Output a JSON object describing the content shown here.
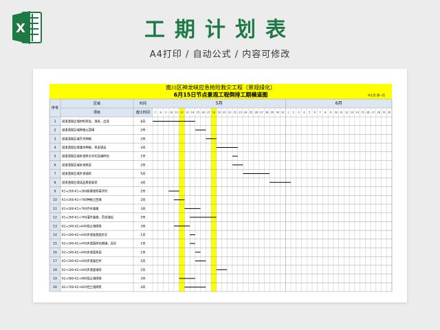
{
  "header": {
    "title": "工期计划表",
    "subtitle": "A4打印 / 自动公式 / 内容可修改",
    "app_icon": "excel-icon",
    "icon_letter": "X"
  },
  "sheet": {
    "project_title": "南川区神龙峡应急抢险救灾工程（景观绿化）",
    "chart_title": "6月15日节点景观工程倒排工期横道图",
    "page_info": "共七页  第一页",
    "columns": {
      "seq": "序号",
      "area": "区域",
      "time": "时间",
      "item": "项目",
      "duration": "施工时间"
    },
    "months": [
      "5月",
      "6月"
    ],
    "may_days": [
      "7",
      "8",
      "9",
      "10",
      "11",
      "12",
      "13",
      "14",
      "15",
      "16",
      "17",
      "18",
      "19",
      "20",
      "21",
      "22",
      "23",
      "24",
      "25",
      "26",
      "27",
      "28",
      "29",
      "30",
      "31"
    ],
    "june_days": [
      "1",
      "2",
      "3",
      "4",
      "5",
      "6",
      "7",
      "8",
      "9",
      "10",
      "11",
      "12",
      "13",
      "14",
      "15",
      "16",
      "17",
      "18",
      "19",
      "20"
    ],
    "highlight_days": [
      "12",
      "18"
    ],
    "rows": [
      {
        "no": "1",
        "item": "道道洒家区域材料转运、清表、出渣",
        "dur": "8天",
        "start": 0,
        "len": 8
      },
      {
        "no": "2",
        "item": "道道洒家区域种植土回填",
        "dur": "2天",
        "start": 8,
        "len": 2
      },
      {
        "no": "3",
        "item": "道道洒家区域乔木种植",
        "dur": "2天",
        "start": 10,
        "len": 2
      },
      {
        "no": "4",
        "item": "道道洒家区域灌木种植，草皮铺设",
        "dur": "4天",
        "start": 12,
        "len": 4
      },
      {
        "no": "5",
        "item": "道道洒家区域步道垫方夯实及铺碎石",
        "dur": "1天",
        "start": 15,
        "len": 1
      },
      {
        "no": "6",
        "item": "道道洒家区域步道垫层",
        "dur": "2天",
        "start": 15,
        "len": 2
      },
      {
        "no": "7",
        "item": "道道洒家区域步道铺装",
        "dur": "5天",
        "start": 17,
        "len": 5
      },
      {
        "no": "8",
        "item": "道道洒家区域成品景观安装",
        "dur": "4天",
        "start": 22,
        "len": 4
      },
      {
        "no": "9",
        "item": "K1+200-K1+360新建钱桥基开挖",
        "dur": "2天",
        "start": 3,
        "len": 2
      },
      {
        "no": "10",
        "item": "K1+260-K1+760种植土回填",
        "dur": "2天",
        "start": 4,
        "len": 2
      },
      {
        "no": "11",
        "item": "K1+260-K1+760乔木栽植",
        "dur": "3天",
        "start": 6,
        "len": 3
      },
      {
        "no": "12",
        "item": "K1+260-K1+760灌木栽植，草皮铺设",
        "dur": "5天",
        "start": 7,
        "len": 5
      },
      {
        "no": "13",
        "item": "K2+340-K2+440挡土墙砌筑",
        "dur": "3天",
        "start": 4,
        "len": 3
      },
      {
        "no": "14",
        "item": "K2+340-K2+440步道面基础夯实",
        "dur": "1天",
        "start": 7,
        "len": 1
      },
      {
        "no": "15",
        "item": "K2+340-K2+440步道面碎石摊铺，压实",
        "dur": "1天",
        "start": 7,
        "len": 1
      },
      {
        "no": "16",
        "item": "K2+340-K2+440步道面垫层",
        "dur": "1天",
        "start": 8,
        "len": 1
      },
      {
        "no": "17",
        "item": "K2+340-K2+440步道面栏杆",
        "dur": "2天",
        "start": 8,
        "len": 2
      },
      {
        "no": "18",
        "item": "K2+340-K2+440步道面铺装",
        "dur": "2天",
        "start": 12,
        "len": 2
      },
      {
        "no": "19",
        "item": "K2+980-K2+960挡土墙砌筑",
        "dur": "3天",
        "start": 5,
        "len": 3
      },
      {
        "no": "20",
        "item": "K2+760-K2+820挡土墙砌筑",
        "dur": "4天",
        "start": 6,
        "len": 4
      }
    ]
  },
  "colors": {
    "brand": "#1d7a45",
    "title_band": "#ffff00",
    "highlight": "#ffff00",
    "header_fill": "#dce6f1",
    "grid": "#9c9c9c",
    "bar": "#000000"
  }
}
